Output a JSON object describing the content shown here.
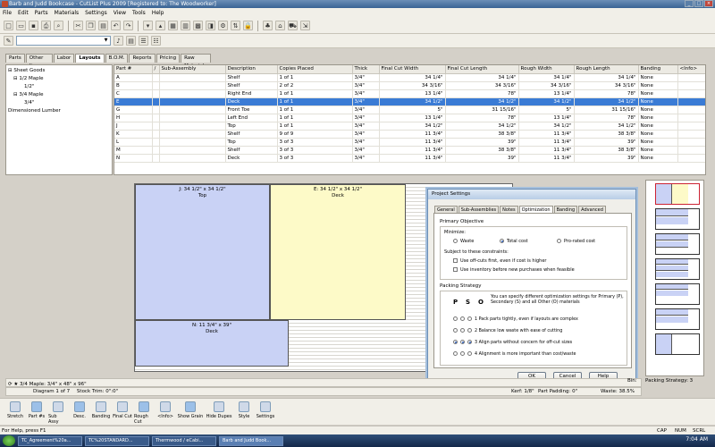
{
  "window": {
    "title": "Barb and Judd Bookcase - CutList Plus 2009 [Registered to: The Woodworker]",
    "controls": [
      "_",
      "□",
      "×"
    ]
  },
  "menu": [
    "File",
    "Edit",
    "Parts",
    "Materials",
    "Settings",
    "View",
    "Tools",
    "Help"
  ],
  "tabs": [
    "Parts",
    "Other Items",
    "Labor",
    "Layouts",
    "B.O.M.",
    "Reports",
    "Pricing",
    "Raw Materials"
  ],
  "tree": [
    "Sheet Goods",
    "1/2 Maple",
    "1/2\"",
    "3/4 Maple",
    "3/4\"",
    "Dimensioned Lumber"
  ],
  "grid": {
    "columns": [
      "Part #",
      "/",
      "Sub-Assembly",
      "Description",
      "Copies Placed",
      "Thick",
      "Final Cut Width",
      "Final Cut Length",
      "Rough Width",
      "Rough Length",
      "Banding",
      "<Info>"
    ],
    "rows": [
      [
        "A",
        "",
        "",
        "Shelf",
        "1 of 1",
        "3/4\"",
        "34 1/4\"",
        "34 1/4\"",
        "34 1/4\"",
        "34 1/4\"",
        "None",
        ""
      ],
      [
        "B",
        "",
        "",
        "Shelf",
        "2 of 2",
        "3/4\"",
        "34 3/16\"",
        "34 3/16\"",
        "34 3/16\"",
        "34 3/16\"",
        "None",
        ""
      ],
      [
        "C",
        "",
        "",
        "Right End",
        "1 of 1",
        "3/4\"",
        "13 1/4\"",
        "78\"",
        "13 1/4\"",
        "78\"",
        "None",
        ""
      ],
      [
        "E",
        "",
        "",
        "Deck",
        "1 of 1",
        "3/4\"",
        "34 1/2\"",
        "34 1/2\"",
        "34 1/2\"",
        "34 1/2\"",
        "None",
        ""
      ],
      [
        "G",
        "",
        "",
        "Front Toe",
        "1 of 1",
        "3/4\"",
        "5\"",
        "31 15/16\"",
        "5\"",
        "31 15/16\"",
        "None",
        ""
      ],
      [
        "H",
        "",
        "",
        "Left End",
        "1 of 1",
        "3/4\"",
        "13 1/4\"",
        "78\"",
        "13 1/4\"",
        "78\"",
        "None",
        ""
      ],
      [
        "J",
        "",
        "",
        "Top",
        "1 of 1",
        "3/4\"",
        "34 1/2\"",
        "34 1/2\"",
        "34 1/2\"",
        "34 1/2\"",
        "None",
        ""
      ],
      [
        "K",
        "",
        "",
        "Shelf",
        "9 of 9",
        "3/4\"",
        "11 3/4\"",
        "38 3/8\"",
        "11 3/4\"",
        "38 3/8\"",
        "None",
        ""
      ],
      [
        "L",
        "",
        "",
        "Top",
        "3 of 3",
        "3/4\"",
        "11 3/4\"",
        "39\"",
        "11 3/4\"",
        "39\"",
        "None",
        ""
      ],
      [
        "M",
        "",
        "",
        "Shelf",
        "3 of 3",
        "3/4\"",
        "11 3/4\"",
        "38 3/8\"",
        "11 3/4\"",
        "38 3/8\"",
        "None",
        ""
      ],
      [
        "N",
        "",
        "",
        "Deck",
        "3 of 3",
        "3/4\"",
        "11 3/4\"",
        "39\"",
        "11 3/4\"",
        "39\"",
        "None",
        ""
      ]
    ],
    "selected_row": 3
  },
  "layout": {
    "parts": [
      {
        "label": "J: 34 1/2\" x 34 1/2\"",
        "sub": "Top"
      },
      {
        "label": "E: 34 1/2\" x 34 1/2\"",
        "sub": "Deck"
      },
      {
        "label": "N: 11 3/4\" x 39\"",
        "sub": "Deck"
      }
    ]
  },
  "dialog": {
    "title": "Project Settings",
    "tabs": [
      "General",
      "Sub-Assemblies",
      "Notes",
      "Optimization",
      "Banding",
      "Advanced"
    ],
    "primary_objective": "Primary Objective",
    "minimize": "Minimize:",
    "options": [
      "Waste",
      "Total cost",
      "Pro-rated cost"
    ],
    "subject": "Subject to these constraints:",
    "chk1": "Use off-cuts first, even if cost is higher",
    "chk2": "Use inventory before new purchases when feasible",
    "packing": "Packing Strategy",
    "pso": [
      "P",
      "S",
      "O"
    ],
    "pso_desc": "You can specify different optimization settings for Primary (P), Secondary (S) and all Other (O) materials",
    "strategies": [
      "1  Pack parts tightly, even if layouts are complex",
      "2  Balance low waste with ease of cutting",
      "3  Align parts without concern for off-cut sizes",
      "4  Alignment is more important than cost/waste"
    ],
    "ok": "OK",
    "cancel": "Cancel",
    "help": "Help"
  },
  "status": {
    "material": "3/4 Maple: 3/4\" x 48\" x 96\"",
    "diagram": "Diagram 1 of 7",
    "stock_trim": "Stock Trim: 0\":0\"",
    "kerf": "Kerf: 1/8\"",
    "part_padding": "Part Padding: 0\"",
    "waste": "Waste: 38.5%",
    "packing_strategy": "Packing Strategy: 3",
    "bin": "Bin:"
  },
  "bottom_buttons": [
    "Stretch",
    "Part #s",
    "Sub Assy",
    "Desc.",
    "Banding",
    "Final Cut",
    "Rough Cut",
    "<Info>",
    "Show Grain",
    "Hide Dupes",
    "Style",
    "Settings"
  ],
  "statusbar": {
    "help": "For Help, press F1",
    "cap": "CAP",
    "num": "NUM",
    "scrl": "SCRL"
  },
  "taskbar": {
    "items": [
      "TC_Agreement%20a...",
      "TC%20STANDARD...",
      "Thermwood / eCabi...",
      "Barb and Judd Book..."
    ],
    "clock": "7:04 AM"
  }
}
